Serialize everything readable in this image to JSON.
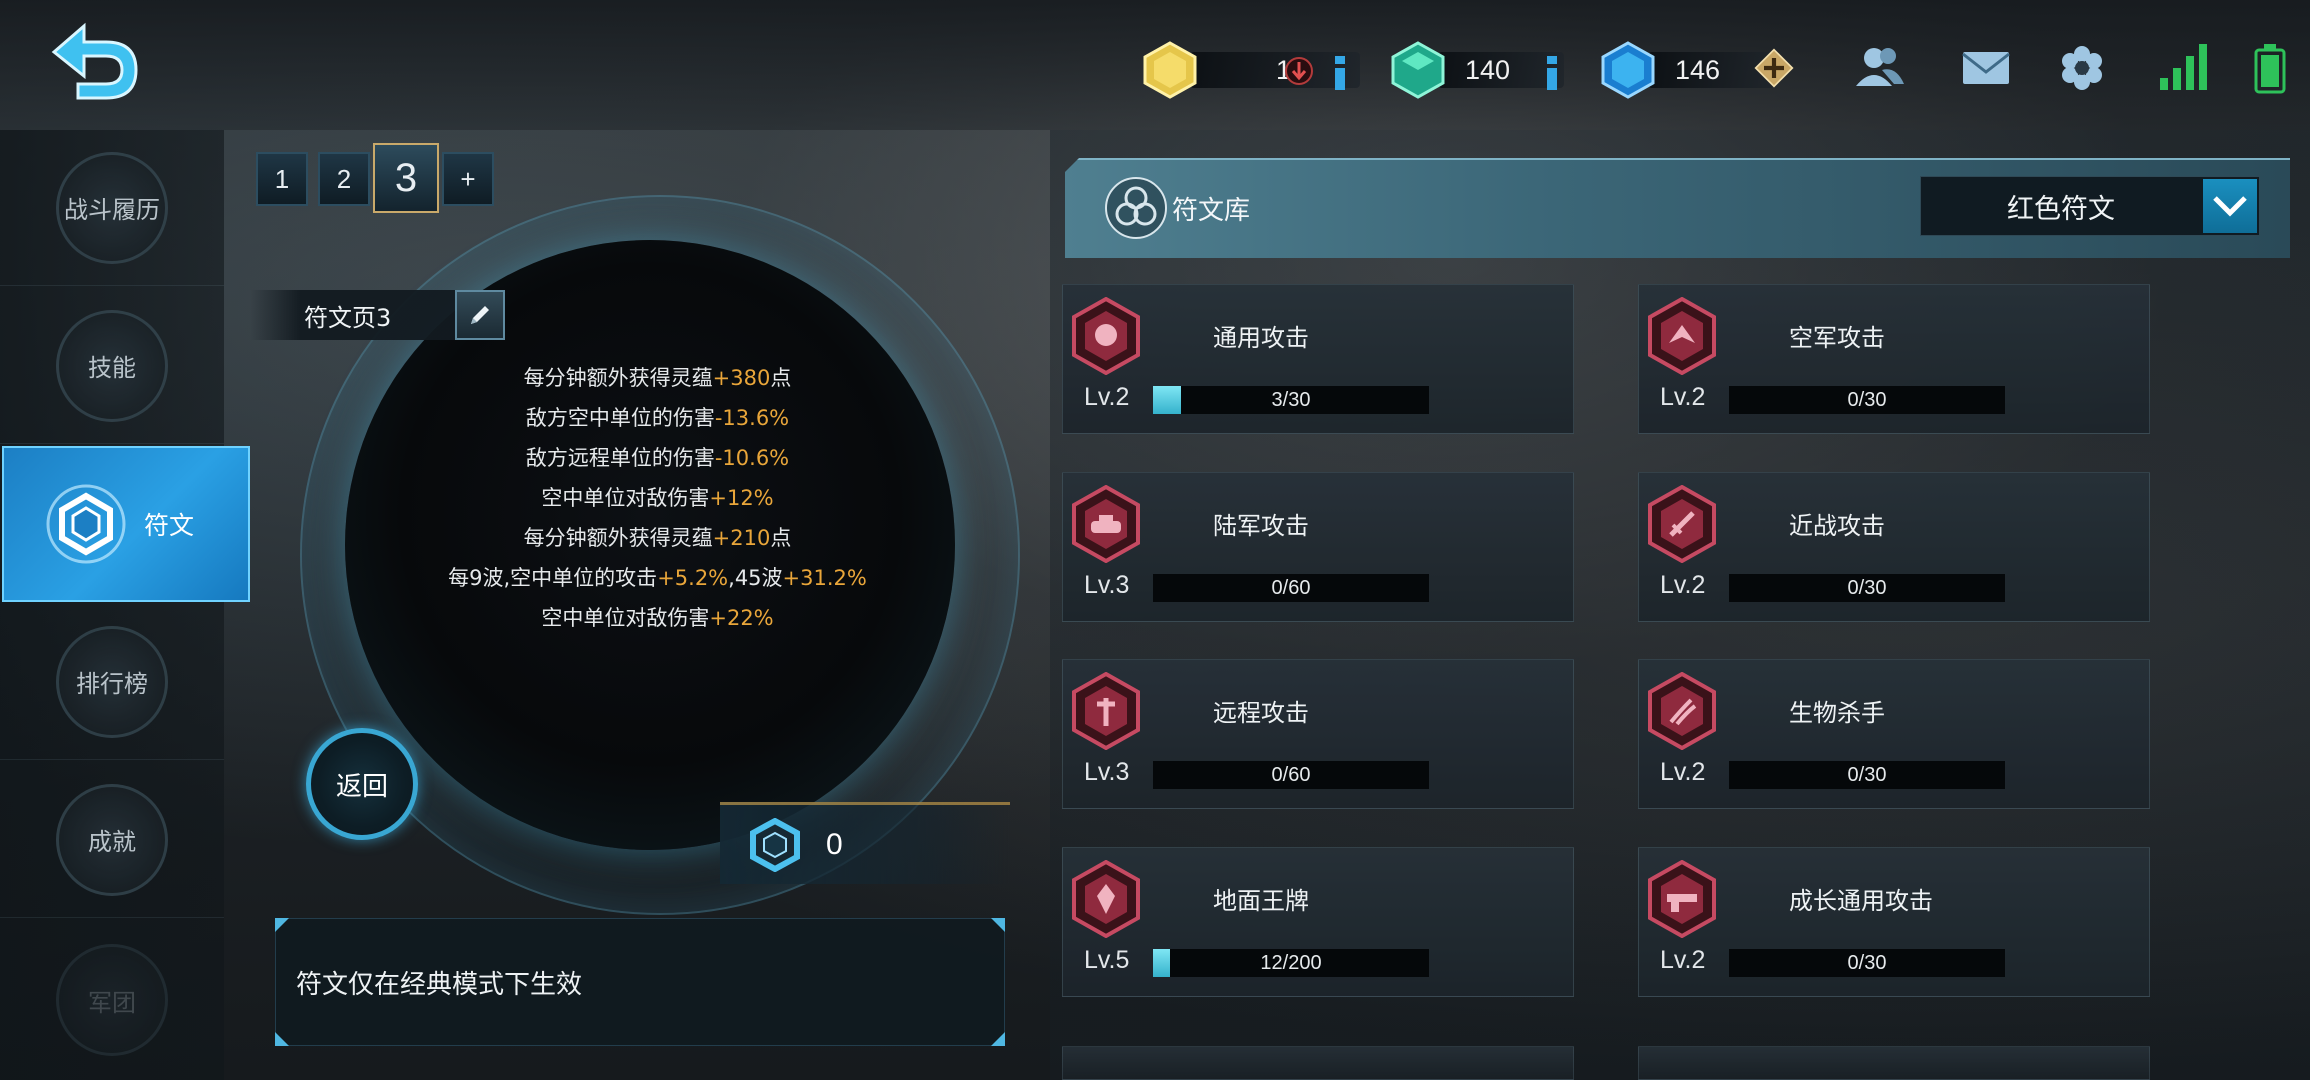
{
  "top_bar": {
    "currencies": [
      {
        "name": "gold-hex",
        "value": "16",
        "action_icon": "info-icon"
      },
      {
        "name": "green-crystal",
        "value": "140",
        "action_icon": "info-icon"
      },
      {
        "name": "blue-crystal",
        "value": "146",
        "action_icon": "plus-icon"
      }
    ],
    "icons": [
      "friends-icon",
      "mail-icon",
      "settings-icon",
      "signal-icon",
      "battery-icon"
    ]
  },
  "sidebar": {
    "items": [
      {
        "label": "战斗履历"
      },
      {
        "label": "技能"
      },
      {
        "label": "符文"
      },
      {
        "label": "排行榜"
      },
      {
        "label": "成就"
      },
      {
        "label": "军团"
      }
    ],
    "active_index": 2
  },
  "page_tabs": {
    "tabs": [
      "1",
      "2",
      "3",
      "+"
    ],
    "active_index": 2
  },
  "rune_page": {
    "name": "符文页3",
    "effects": [
      {
        "prefix": "每分钟额外获得灵蕴",
        "value": "+380",
        "suffix": "点"
      },
      {
        "prefix": "敌方空中单位的伤害",
        "value": "-13.6%",
        "suffix": ""
      },
      {
        "prefix": "敌方远程单位的伤害",
        "value": "-10.6%",
        "suffix": ""
      },
      {
        "prefix": "空中单位对敌伤害",
        "value": "+12%",
        "suffix": ""
      },
      {
        "prefix": "每分钟额外获得灵蕴",
        "value": "+210",
        "suffix": "点"
      },
      {
        "prefix": "每9波,空中单位的攻击",
        "value": "+5.2%",
        "suffix": ",45波",
        "value2": "+31.2%"
      },
      {
        "prefix": "空中单位对敌伤害",
        "value": "+22%",
        "suffix": ""
      }
    ],
    "return_label": "返回",
    "rune_count": "0",
    "notice": "符文仅在经典模式下生效"
  },
  "library": {
    "title": "符文库",
    "filter": "红色符文",
    "runes": [
      {
        "name": "通用攻击",
        "level": "Lv.2",
        "progress": "3/30",
        "fraction": 0.1,
        "icon": "skull-rune-icon"
      },
      {
        "name": "空军攻击",
        "level": "Lv.2",
        "progress": "0/30",
        "fraction": 0,
        "icon": "wing-rune-icon"
      },
      {
        "name": "陆军攻击",
        "level": "Lv.3",
        "progress": "0/60",
        "fraction": 0,
        "icon": "tank-rune-icon"
      },
      {
        "name": "近战攻击",
        "level": "Lv.2",
        "progress": "0/30",
        "fraction": 0,
        "icon": "sword-rune-icon"
      },
      {
        "name": "远程攻击",
        "level": "Lv.3",
        "progress": "0/60",
        "fraction": 0,
        "icon": "arrow-rune-icon"
      },
      {
        "name": "生物杀手",
        "level": "Lv.2",
        "progress": "0/30",
        "fraction": 0,
        "icon": "claw-rune-icon"
      },
      {
        "name": "地面王牌",
        "level": "Lv.5",
        "progress": "12/200",
        "fraction": 0.06,
        "icon": "emblem-rune-icon"
      },
      {
        "name": "成长通用攻击",
        "level": "Lv.2",
        "progress": "0/30",
        "fraction": 0,
        "icon": "gun-rune-icon"
      }
    ]
  },
  "colors": {
    "accent": "#2aa0e4",
    "highlight": "#e9a63a",
    "progress": "#35b2cc",
    "rune_red": "#a8324a"
  }
}
